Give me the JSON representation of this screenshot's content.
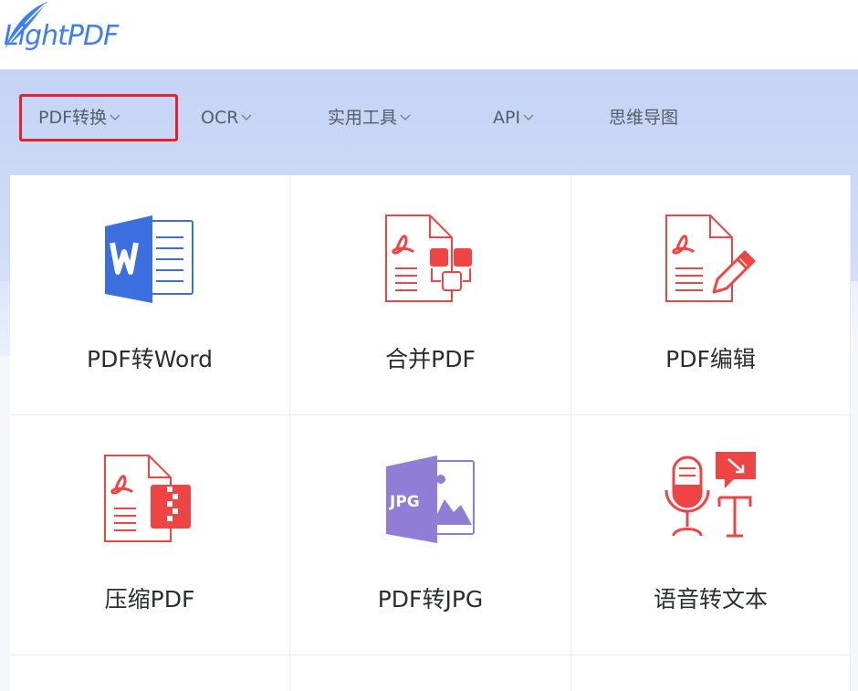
{
  "brand": {
    "logo_text": "LightPDF"
  },
  "nav": {
    "items": [
      {
        "label": "PDF转换",
        "has_dropdown": true,
        "selected": true
      },
      {
        "label": "OCR",
        "has_dropdown": true
      },
      {
        "label": "实用工具",
        "has_dropdown": true
      },
      {
        "label": "API",
        "has_dropdown": true
      },
      {
        "label": "思维导图",
        "has_dropdown": false
      }
    ]
  },
  "tools": [
    {
      "label": "PDF转Word",
      "icon": "word-document-icon"
    },
    {
      "label": "合并PDF",
      "icon": "merge-pdf-icon"
    },
    {
      "label": "PDF编辑",
      "icon": "edit-pdf-icon"
    },
    {
      "label": "压缩PDF",
      "icon": "compress-pdf-icon"
    },
    {
      "label": "PDF转JPG",
      "icon": "jpg-image-icon"
    },
    {
      "label": "语音转文本",
      "icon": "speech-to-text-icon"
    }
  ],
  "colors": {
    "brand_blue": "#3d7ef7",
    "pdf_red": "#ef4444",
    "word_blue": "#3b6fe0",
    "jpg_purple": "#8f7dd6",
    "highlight_red": "#e8202a"
  }
}
